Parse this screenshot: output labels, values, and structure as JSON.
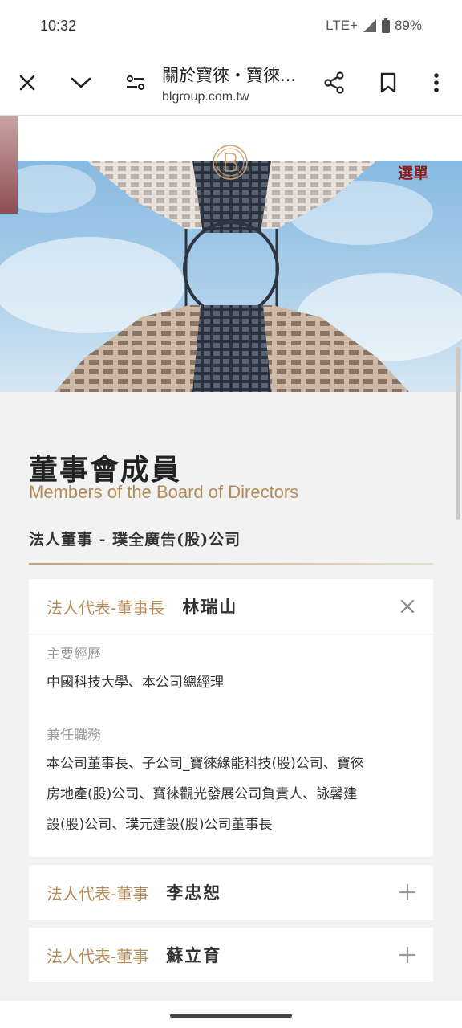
{
  "status": {
    "time": "10:32",
    "network": "LTE+",
    "battery": "89%"
  },
  "browser": {
    "page_title": "關於寶徠・寶徠...",
    "url": "blgroup.com.tw"
  },
  "hero": {
    "menu_label": "選單"
  },
  "section": {
    "title": "董事會成員",
    "subtitle": "Members of the Board of Directors",
    "company": "法人董事 - 璞全廣告(股)公司"
  },
  "members": [
    {
      "role": "法人代表-董事長",
      "name": "林瑞山",
      "expanded": true,
      "experience_label": "主要經歷",
      "experience": "中國科技大學、本公司總經理",
      "concurrent_label": "兼任職務",
      "concurrent_lines": [
        "本公司董事長、子公司_寶徠綠能科技(股)公司、寶徠",
        "房地產(股)公司、寶徠觀光發展公司負責人、詠馨建",
        "設(股)公司、璞元建設(股)公司董事長"
      ]
    },
    {
      "role": "法人代表-董事",
      "name": "李忠恕",
      "expanded": false
    },
    {
      "role": "法人代表-董事",
      "name": "蘇立育",
      "expanded": false
    }
  ],
  "colors": {
    "accent_gold": "#b38b5a",
    "menu_red": "#8a1c1c"
  }
}
